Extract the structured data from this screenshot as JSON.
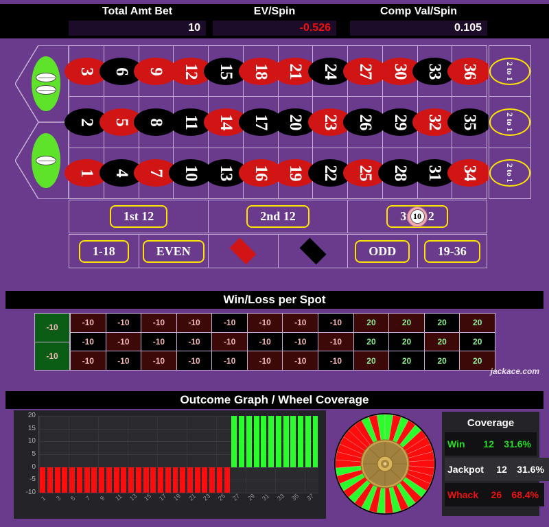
{
  "header": {
    "stats": [
      {
        "label": "Total Amt Bet",
        "value": "10",
        "negative": false
      },
      {
        "label": "EV/Spin",
        "value": "-0.526",
        "negative": true
      },
      {
        "label": "Comp Val/Spin",
        "value": "0.105",
        "negative": false
      }
    ]
  },
  "table": {
    "zeros": [
      {
        "label": "00",
        "pips": 2
      },
      {
        "label": "0",
        "pips": 1
      }
    ],
    "numbers": [
      {
        "n": "3",
        "color": "red"
      },
      {
        "n": "6",
        "color": "black"
      },
      {
        "n": "9",
        "color": "red"
      },
      {
        "n": "12",
        "color": "red"
      },
      {
        "n": "15",
        "color": "black"
      },
      {
        "n": "18",
        "color": "red"
      },
      {
        "n": "21",
        "color": "red"
      },
      {
        "n": "24",
        "color": "black"
      },
      {
        "n": "27",
        "color": "red"
      },
      {
        "n": "30",
        "color": "red"
      },
      {
        "n": "33",
        "color": "black"
      },
      {
        "n": "36",
        "color": "red"
      },
      {
        "n": "2",
        "color": "black"
      },
      {
        "n": "5",
        "color": "red"
      },
      {
        "n": "8",
        "color": "black"
      },
      {
        "n": "11",
        "color": "black"
      },
      {
        "n": "14",
        "color": "red"
      },
      {
        "n": "17",
        "color": "black"
      },
      {
        "n": "20",
        "color": "black"
      },
      {
        "n": "23",
        "color": "red"
      },
      {
        "n": "26",
        "color": "black"
      },
      {
        "n": "29",
        "color": "black"
      },
      {
        "n": "32",
        "color": "red"
      },
      {
        "n": "35",
        "color": "black"
      },
      {
        "n": "1",
        "color": "red"
      },
      {
        "n": "4",
        "color": "black"
      },
      {
        "n": "7",
        "color": "red"
      },
      {
        "n": "10",
        "color": "black"
      },
      {
        "n": "13",
        "color": "black"
      },
      {
        "n": "16",
        "color": "red"
      },
      {
        "n": "19",
        "color": "red"
      },
      {
        "n": "22",
        "color": "black"
      },
      {
        "n": "25",
        "color": "red"
      },
      {
        "n": "28",
        "color": "black"
      },
      {
        "n": "31",
        "color": "black"
      },
      {
        "n": "34",
        "color": "red"
      }
    ],
    "column_bets": [
      "2 to 1",
      "2 to 1",
      "2 to 1"
    ],
    "dozens": [
      "1st 12",
      "2nd 12",
      "3rd 12"
    ],
    "outside": [
      {
        "label": "1-18",
        "type": "text"
      },
      {
        "label": "EVEN",
        "type": "text"
      },
      {
        "label": "RED",
        "type": "diamond-red"
      },
      {
        "label": "BLACK",
        "type": "diamond-black"
      },
      {
        "label": "ODD",
        "type": "text"
      },
      {
        "label": "19-36",
        "type": "text"
      }
    ],
    "chip": {
      "amount": "10",
      "on_bet": "3rd 12"
    }
  },
  "winloss": {
    "title": "Win/Loss per Spot",
    "watermark": "jackace.com",
    "zero_values": [
      "-10",
      "-10"
    ],
    "values": [
      {
        "v": "-10",
        "color": "red"
      },
      {
        "v": "-10",
        "color": "black"
      },
      {
        "v": "-10",
        "color": "red"
      },
      {
        "v": "-10",
        "color": "red"
      },
      {
        "v": "-10",
        "color": "black"
      },
      {
        "v": "-10",
        "color": "red"
      },
      {
        "v": "-10",
        "color": "red"
      },
      {
        "v": "-10",
        "color": "black"
      },
      {
        "v": "20",
        "color": "red"
      },
      {
        "v": "20",
        "color": "red"
      },
      {
        "v": "20",
        "color": "black"
      },
      {
        "v": "20",
        "color": "red"
      },
      {
        "v": "-10",
        "color": "black"
      },
      {
        "v": "-10",
        "color": "red"
      },
      {
        "v": "-10",
        "color": "black"
      },
      {
        "v": "-10",
        "color": "black"
      },
      {
        "v": "-10",
        "color": "red"
      },
      {
        "v": "-10",
        "color": "black"
      },
      {
        "v": "-10",
        "color": "black"
      },
      {
        "v": "-10",
        "color": "red"
      },
      {
        "v": "20",
        "color": "black"
      },
      {
        "v": "20",
        "color": "black"
      },
      {
        "v": "20",
        "color": "red"
      },
      {
        "v": "20",
        "color": "black"
      },
      {
        "v": "-10",
        "color": "red"
      },
      {
        "v": "-10",
        "color": "black"
      },
      {
        "v": "-10",
        "color": "red"
      },
      {
        "v": "-10",
        "color": "black"
      },
      {
        "v": "-10",
        "color": "black"
      },
      {
        "v": "-10",
        "color": "red"
      },
      {
        "v": "-10",
        "color": "red"
      },
      {
        "v": "-10",
        "color": "black"
      },
      {
        "v": "20",
        "color": "red"
      },
      {
        "v": "20",
        "color": "black"
      },
      {
        "v": "20",
        "color": "black"
      },
      {
        "v": "20",
        "color": "red"
      }
    ]
  },
  "outcome": {
    "title": "Outcome Graph / Wheel Coverage",
    "coverage": {
      "title": "Coverage",
      "rows": [
        {
          "label": "Win",
          "count": "12",
          "pct": "31.6%",
          "kind": "win"
        },
        {
          "label": "Jackpot",
          "count": "12",
          "pct": "31.6%",
          "kind": "jackpot"
        },
        {
          "label": "Whack",
          "count": "26",
          "pct": "68.4%",
          "kind": "whack"
        }
      ]
    }
  },
  "chart_data": {
    "type": "bar",
    "title": "Outcome Graph / Wheel Coverage",
    "xlabel": "",
    "ylabel": "",
    "ylim": [
      -10,
      20
    ],
    "yticks": [
      20,
      15,
      10,
      5,
      0,
      -5,
      -10
    ],
    "xticks": [
      "1",
      "3",
      "5",
      "7",
      "9",
      "11",
      "13",
      "15",
      "17",
      "19",
      "21",
      "23",
      "25",
      "27",
      "29",
      "31",
      "33",
      "35",
      "37"
    ],
    "x": [
      1,
      2,
      3,
      4,
      5,
      6,
      7,
      8,
      9,
      10,
      11,
      12,
      13,
      14,
      15,
      16,
      17,
      18,
      19,
      20,
      21,
      22,
      23,
      24,
      25,
      26,
      27,
      28,
      29,
      30,
      31,
      32,
      33,
      34,
      35,
      36,
      37,
      38
    ],
    "values": [
      -10,
      -10,
      -10,
      -10,
      -10,
      -10,
      -10,
      -10,
      -10,
      -10,
      -10,
      -10,
      -10,
      -10,
      -10,
      -10,
      -10,
      -10,
      -10,
      -10,
      -10,
      -10,
      -10,
      -10,
      -10,
      -10,
      20,
      20,
      20,
      20,
      20,
      20,
      20,
      20,
      20,
      20,
      20,
      20
    ],
    "bar_colors": [
      "#fc0d0d",
      "#fc0d0d",
      "#fc0d0d",
      "#fc0d0d",
      "#fc0d0d",
      "#fc0d0d",
      "#fc0d0d",
      "#fc0d0d",
      "#fc0d0d",
      "#fc0d0d",
      "#fc0d0d",
      "#fc0d0d",
      "#fc0d0d",
      "#fc0d0d",
      "#fc0d0d",
      "#fc0d0d",
      "#fc0d0d",
      "#fc0d0d",
      "#fc0d0d",
      "#fc0d0d",
      "#fc0d0d",
      "#fc0d0d",
      "#fc0d0d",
      "#fc0d0d",
      "#fc0d0d",
      "#fc0d0d",
      "#2bfc2b",
      "#2bfc2b",
      "#2bfc2b",
      "#2bfc2b",
      "#2bfc2b",
      "#2bfc2b",
      "#2bfc2b",
      "#2bfc2b",
      "#2bfc2b",
      "#2bfc2b",
      "#2bfc2b",
      "#2bfc2b"
    ],
    "grid": true,
    "legend": "none"
  },
  "wheel": {
    "segment_colors": [
      "#2bfc2b",
      "#fc0d0d",
      "#2bfc2b",
      "#fc0d0d",
      "#2bfc2b",
      "#fc0d0d",
      "#fc0d0d",
      "#fc0d0d",
      "#fc0d0d",
      "#fc0d0d",
      "#fc0d0d",
      "#fc0d0d",
      "#fc0d0d",
      "#2bfc2b",
      "#fc0d0d",
      "#2bfc2b",
      "#fc0d0d",
      "#2bfc2b",
      "#fc0d0d",
      "#2bfc2b",
      "#fc0d0d",
      "#2bfc2b",
      "#fc0d0d",
      "#2bfc2b",
      "#fc0d0d",
      "#2bfc2b",
      "#fc0d0d",
      "#2bfc2b",
      "#fc0d0d",
      "#fc0d0d",
      "#fc0d0d",
      "#fc0d0d",
      "#fc0d0d",
      "#fc0d0d",
      "#fc0d0d",
      "#2bfc2b",
      "#fc0d0d",
      "#2bfc2b"
    ]
  },
  "colors": {
    "felt": "#6a3b8c",
    "red": "#d11515",
    "black": "#000000",
    "green": "#5ee22a",
    "yellow": "#ffe400"
  }
}
